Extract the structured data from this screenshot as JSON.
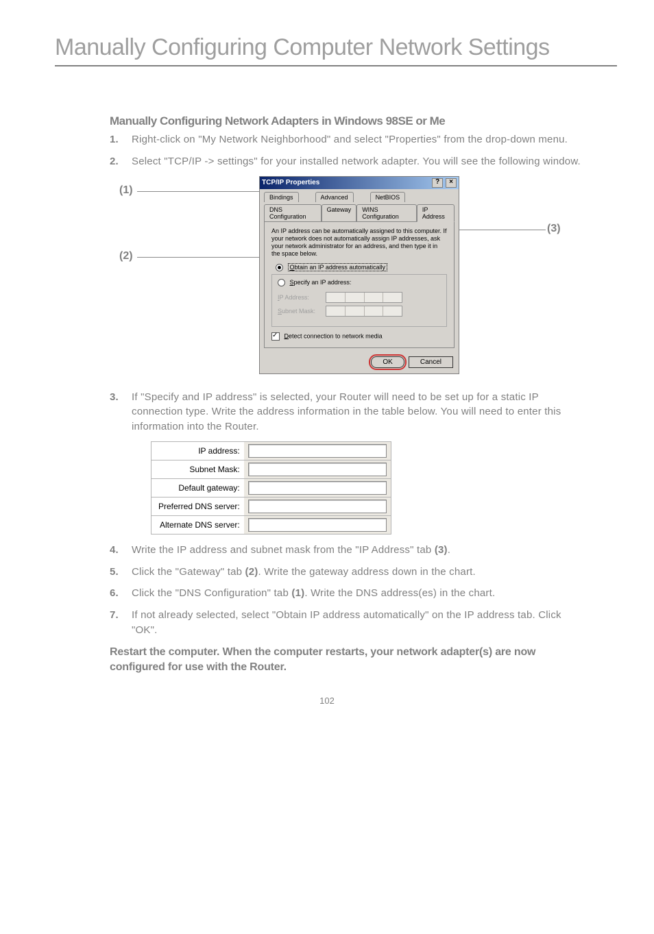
{
  "chapterTitle": "Manually Configuring Computer Network Settings",
  "subhead": "Manually Configuring Network Adapters in Windows 98SE or Me",
  "steps": {
    "s1": {
      "num": "1.",
      "text": "Right-click on \"My Network Neighborhood\" and select \"Properties\" from the drop-down menu."
    },
    "s2": {
      "num": "2.",
      "text": "Select \"TCP/IP -> settings\" for your installed network adapter. You will see the following window."
    },
    "s3": {
      "num": "3.",
      "text": "If \"Specify and IP address\" is selected, your Router will need to be set up for a static IP connection type. Write the address information in the table below. You will need to enter this information into the Router."
    },
    "s4": {
      "num": "4.",
      "text_pre": "Write the IP address and subnet mask from the \"IP Address\" tab ",
      "ref": "(3)",
      "text_post": "."
    },
    "s5": {
      "num": "5.",
      "text_pre": "Click the \"Gateway\" tab ",
      "ref": "(2)",
      "text_post": ". Write the gateway address down in the chart."
    },
    "s6": {
      "num": "6.",
      "text_pre": "Click the \"DNS Configuration\" tab ",
      "ref": "(1)",
      "text_post": ". Write the DNS address(es) in the chart."
    },
    "s7": {
      "num": "7.",
      "text": "If not already selected, select \"Obtain IP address automatically\" on the IP address tab. Click \"OK\"."
    }
  },
  "callouts": {
    "c1": "(1)",
    "c2": "(2)",
    "c3": "(3)"
  },
  "dialog": {
    "title": "TCP/IP Properties",
    "helpBtn": "?",
    "closeBtn": "×",
    "tabs": {
      "r1": {
        "bindings": "Bindings",
        "advanced": "Advanced",
        "netbios": "NetBIOS"
      },
      "r2": {
        "dns": "DNS Configuration",
        "gateway": "Gateway",
        "wins": "WINS Configuration",
        "ipaddr": "IP Address"
      }
    },
    "desc": "An IP address can be automatically assigned to this computer. If your network does not automatically assign IP addresses, ask your network administrator for an address, and then type it in the space below.",
    "radio_obtain_pre": "O",
    "radio_obtain": "btain an IP address automatically",
    "radio_specify_pre": "S",
    "radio_specify": "pecify an IP address:",
    "ip_label_pre": "I",
    "ip_label": "P Address:",
    "subnet_label_pre": "S",
    "subnet_label": "ubnet Mask:",
    "detect_pre": "D",
    "detect": "etect connection to network media",
    "ok": "OK",
    "cancel": "Cancel"
  },
  "addrTable": {
    "ip": "IP address:",
    "subnet": "Subnet Mask:",
    "gateway": "Default gateway:",
    "pdns": "Preferred DNS server:",
    "adns": "Alternate DNS server:"
  },
  "restart": "Restart the computer. When the computer restarts, your network adapter(s) are now configured for use with the Router.",
  "pageNum": "102"
}
